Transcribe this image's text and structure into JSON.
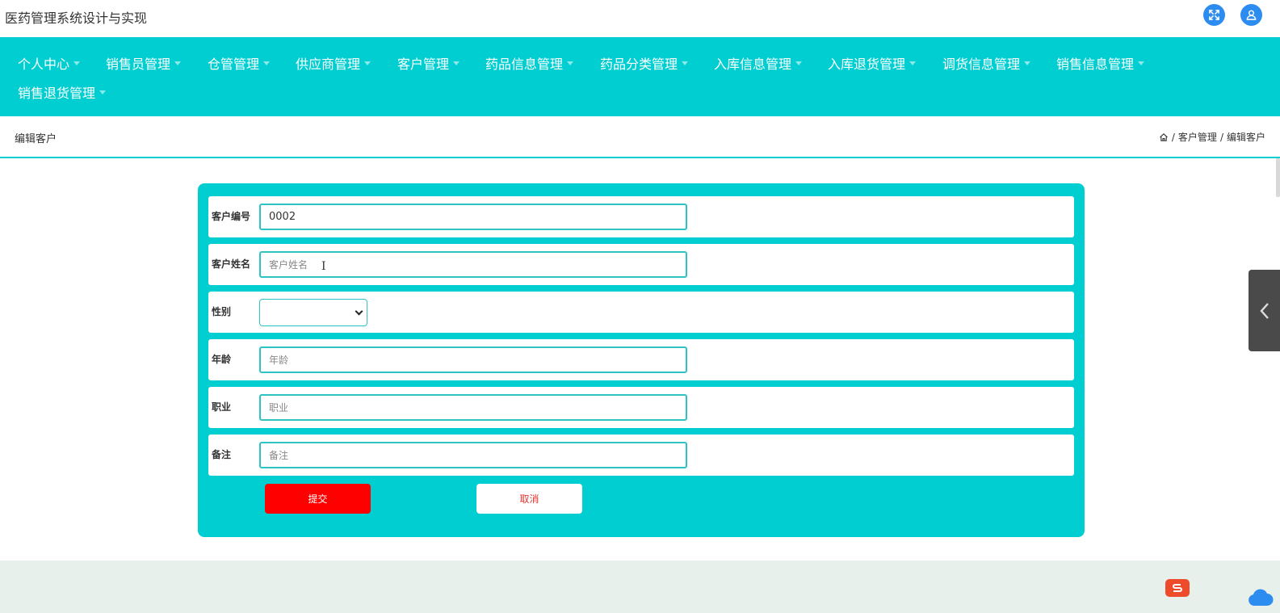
{
  "app": {
    "title": "医药管理系统设计与实现"
  },
  "topbar": {
    "fullscreen_icon": "expand-icon",
    "user_icon": "user-icon",
    "accent": "#2d8cf0"
  },
  "nav": {
    "color": "#00ced1",
    "items": [
      {
        "label": "个人中心"
      },
      {
        "label": "销售员管理"
      },
      {
        "label": "仓管管理"
      },
      {
        "label": "供应商管理"
      },
      {
        "label": "客户管理"
      },
      {
        "label": "药品信息管理"
      },
      {
        "label": "药品分类管理"
      },
      {
        "label": "入库信息管理"
      },
      {
        "label": "入库退货管理"
      },
      {
        "label": "调货信息管理"
      },
      {
        "label": "销售信息管理"
      },
      {
        "label": "销售退货管理"
      }
    ]
  },
  "page": {
    "heading": "编辑客户",
    "breadcrumb": {
      "home_icon": "home-icon",
      "sep": "/",
      "section": "客户管理",
      "current": "编辑客户"
    }
  },
  "form": {
    "fields": [
      {
        "label": "客户编号",
        "value": "0002",
        "placeholder": ""
      },
      {
        "label": "客户姓名",
        "value": "",
        "placeholder": "客户姓名"
      },
      {
        "label": "性别",
        "value": ""
      },
      {
        "label": "年龄",
        "value": "",
        "placeholder": "年龄"
      },
      {
        "label": "职业",
        "value": "",
        "placeholder": "职业"
      },
      {
        "label": "备注",
        "value": "",
        "placeholder": "备注"
      }
    ],
    "submit_label": "提交",
    "cancel_label": "取消",
    "submit_color": "#ff0000"
  },
  "side_tab": {
    "icon": "chevron-left-icon"
  }
}
